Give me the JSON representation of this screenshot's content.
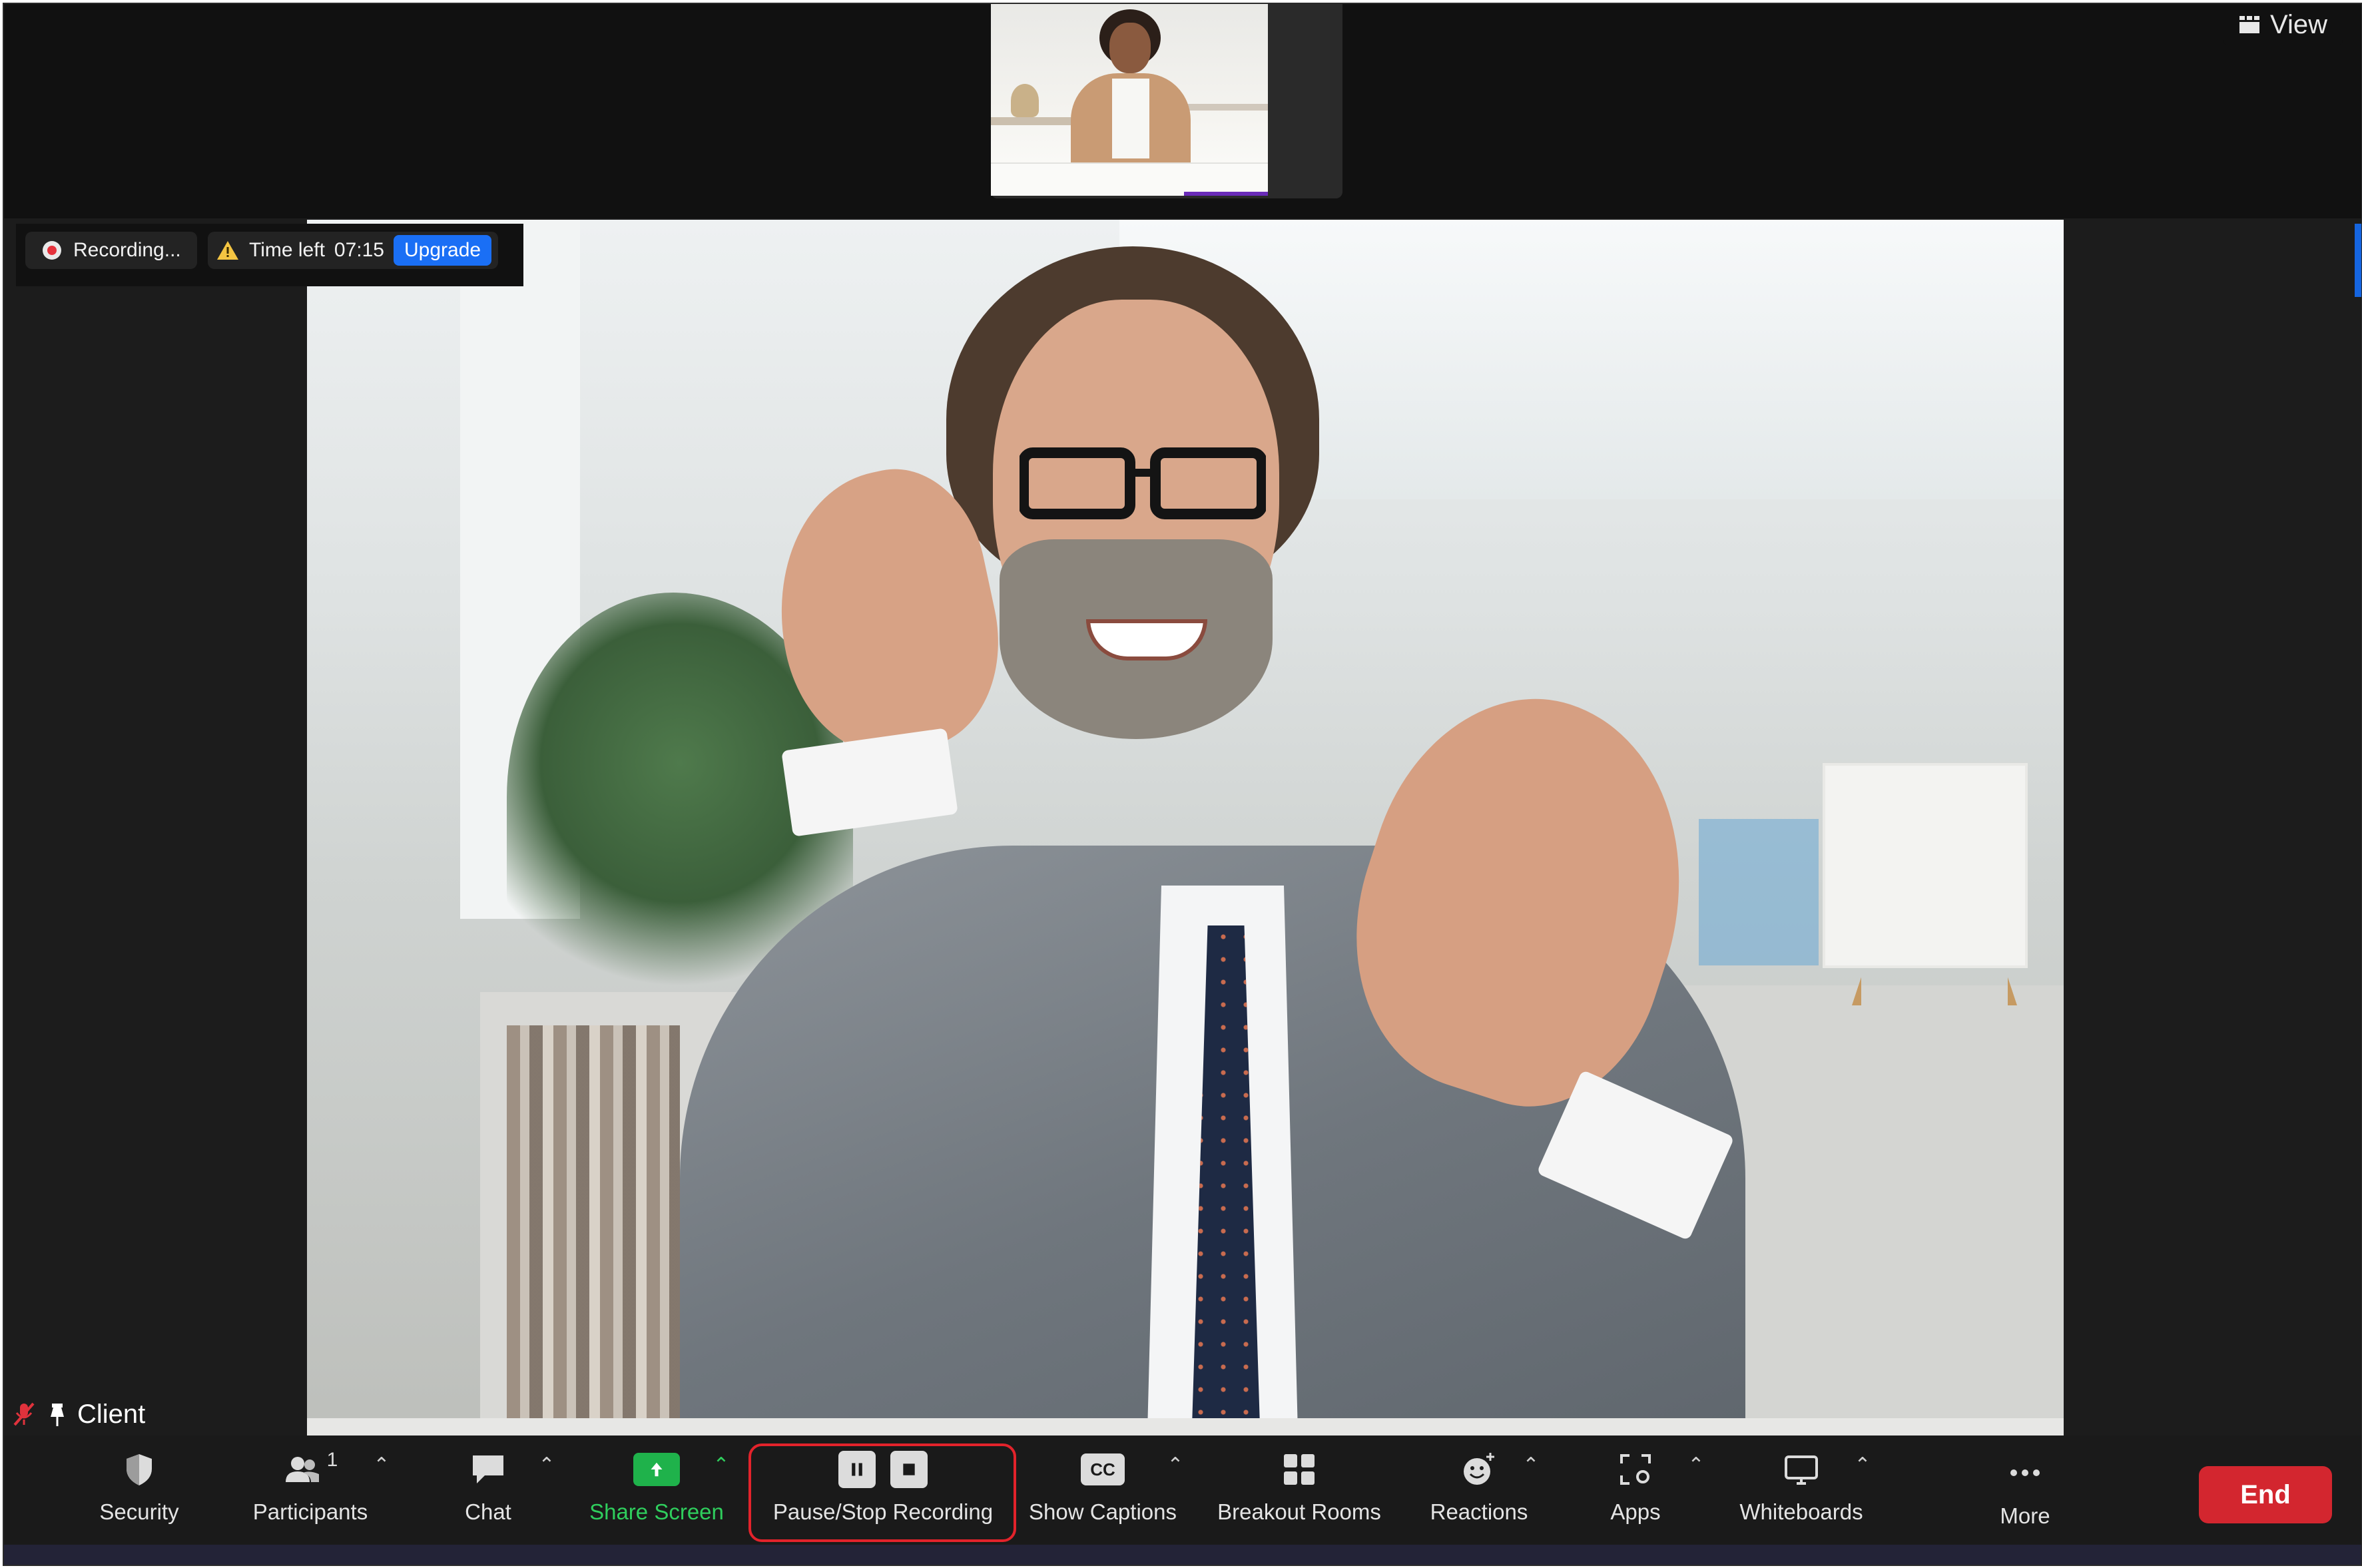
{
  "top": {
    "view_label": "View"
  },
  "recording": {
    "status": "Recording...",
    "time_left_label": "Time left",
    "time_left_value": "07:15",
    "upgrade_label": "Upgrade"
  },
  "participant": {
    "name": "Client"
  },
  "toolbar": {
    "security": "Security",
    "participants": "Participants",
    "participants_count": "1",
    "chat": "Chat",
    "share_screen": "Share Screen",
    "pause_stop_recording": "Pause/Stop Recording",
    "captions_icon_text": "CC",
    "show_captions": "Show Captions",
    "breakout_rooms": "Breakout Rooms",
    "reactions": "Reactions",
    "apps": "Apps",
    "whiteboards": "Whiteboards",
    "more": "More",
    "end": "End"
  },
  "colors": {
    "end_button": "#d3262f",
    "share_green": "#1fb24b",
    "upgrade_blue": "#1a6ff5",
    "highlight_red": "#e3232b"
  }
}
